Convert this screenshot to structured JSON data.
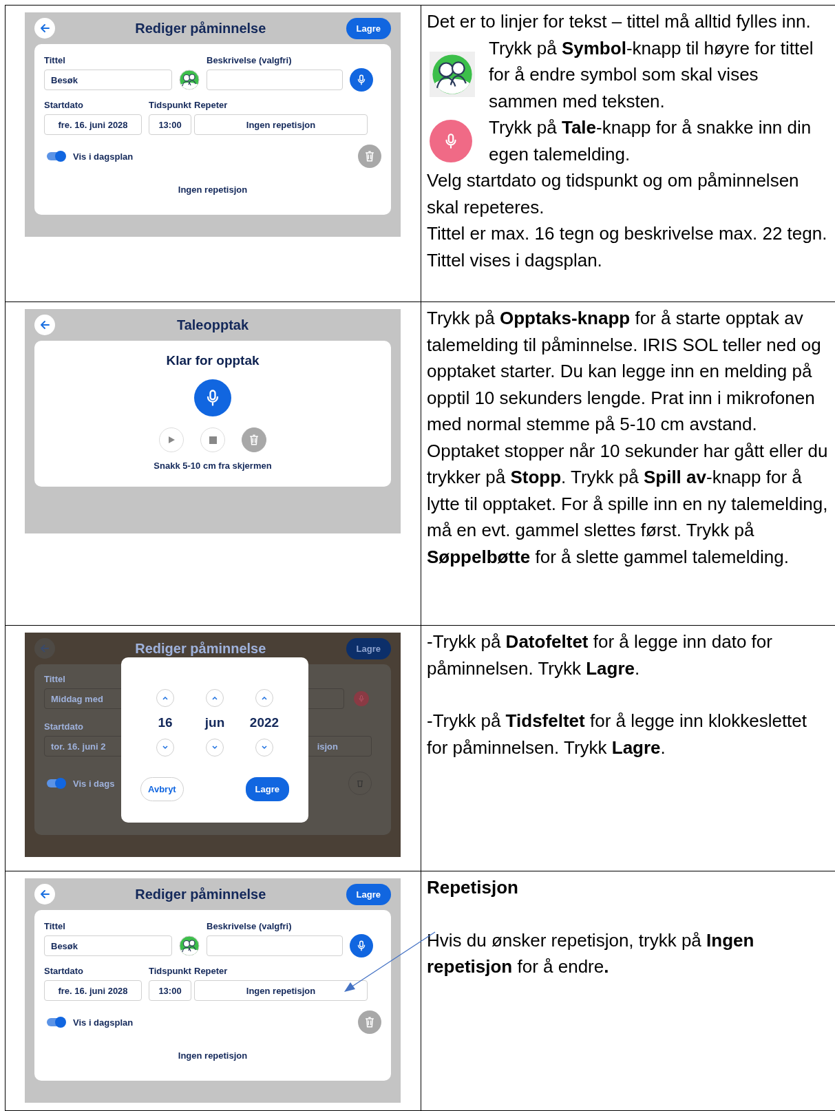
{
  "rows": [
    {
      "screen": {
        "kind": "edit",
        "title": "Rediger påminnelse",
        "save_button": "Lagre",
        "title_label": "Tittel",
        "title_value": "Besøk",
        "description_label": "Beskrivelse (valgfri)",
        "date_label": "Startdato",
        "date_value": "fre. 16. juni 2028",
        "time_label": "Tidspunkt",
        "time_value": "13:00",
        "repeat_label": "Repeter",
        "repeat_value": "Ingen repetisjon",
        "toggle": {
          "label": "Vis i dagsplan",
          "on": true
        },
        "summary": "Ingen repetisjon"
      },
      "text": [
        {
          "kind": "text",
          "text": "Det er to linjer for tekst – tittel må alltid fylles inn."
        },
        {
          "kind": "symbol",
          "text": "Trykk på **Symbol**-knapp til høyre for tittel for å endre symbol som skal vises sammen med teksten."
        },
        {
          "kind": "mic",
          "text": "Trykk på **Tale**-knapp for å snakke inn din egen talemelding."
        },
        {
          "kind": "text",
          "text": "Velg startdato og tidspunkt og om påminnelsen skal repeteres."
        },
        {
          "kind": "text",
          "text": "Tittel er max. 16 tegn og beskrivelse max. 22 tegn. Tittel vises i dagsplan."
        }
      ]
    },
    {
      "screen": {
        "kind": "recording",
        "title": "Taleopptak",
        "heading": "Klar for opptak",
        "hint": "Snakk 5-10 cm fra skjermen"
      },
      "text": [
        {
          "kind": "text",
          "text": "Trykk på **Opptaks-knapp** for å starte opptak av talemelding til påminnelse. IRIS SOL teller ned og opptaket starter. Du kan legge inn en melding på opptil 10 sekunders lengde. Prat inn i mikrofonen med normal stemme på 5-10 cm avstand. Opptaket stopper når 10 sekunder har gått eller du trykker på **Stopp**. Trykk på **Spill av**-knapp for å lytte til opptaket. For å spille inn en ny talemelding, må en evt. gammel slettes først. Trykk på **Søppelbøtte** for å slette gammel talemelding."
        }
      ]
    },
    {
      "screen": {
        "kind": "date_picker",
        "title": "Rediger påminnelse",
        "save_button": "Lagre",
        "title_label": "Tittel",
        "title_value": "Middag med",
        "date_label": "Startdato",
        "date_value": "tor. 16. juni 2",
        "repeat_value": "isjon",
        "toggle": {
          "label": "Vis i dags",
          "on": true
        },
        "dialog": {
          "columns": [
            "16",
            "jun",
            "2022"
          ],
          "cancel_button": "Avbryt",
          "save_button": "Lagre"
        }
      },
      "text": [
        {
          "kind": "text",
          "text": "-Trykk på **Datofeltet** for å legge inn dato for påminnelsen. Trykk **Lagre**."
        },
        {
          "kind": "gap"
        },
        {
          "kind": "text",
          "text": "-Trykk på **Tidsfeltet** for å legge inn klokkeslettet for påminnelsen. Trykk **Lagre**."
        }
      ]
    },
    {
      "screen": {
        "kind": "edit",
        "title": "Rediger påminnelse",
        "save_button": "Lagre",
        "title_label": "Tittel",
        "title_value": "Besøk",
        "description_label": "Beskrivelse (valgfri)",
        "date_label": "Startdato",
        "date_value": "fre. 16. juni 2028",
        "time_label": "Tidspunkt",
        "time_value": "13:00",
        "repeat_label": "Repeter",
        "repeat_value": "Ingen repetisjon",
        "toggle": {
          "label": "Vis i dagsplan",
          "on": true
        },
        "summary": "Ingen repetisjon"
      },
      "arrow": true,
      "text": [
        {
          "kind": "heading",
          "text": "Repetisjon"
        },
        {
          "kind": "gap"
        },
        {
          "kind": "text",
          "text": "Hvis du ønsker repetisjon, trykk på **Ingen repetisjon** for å endre**.**"
        }
      ]
    }
  ]
}
